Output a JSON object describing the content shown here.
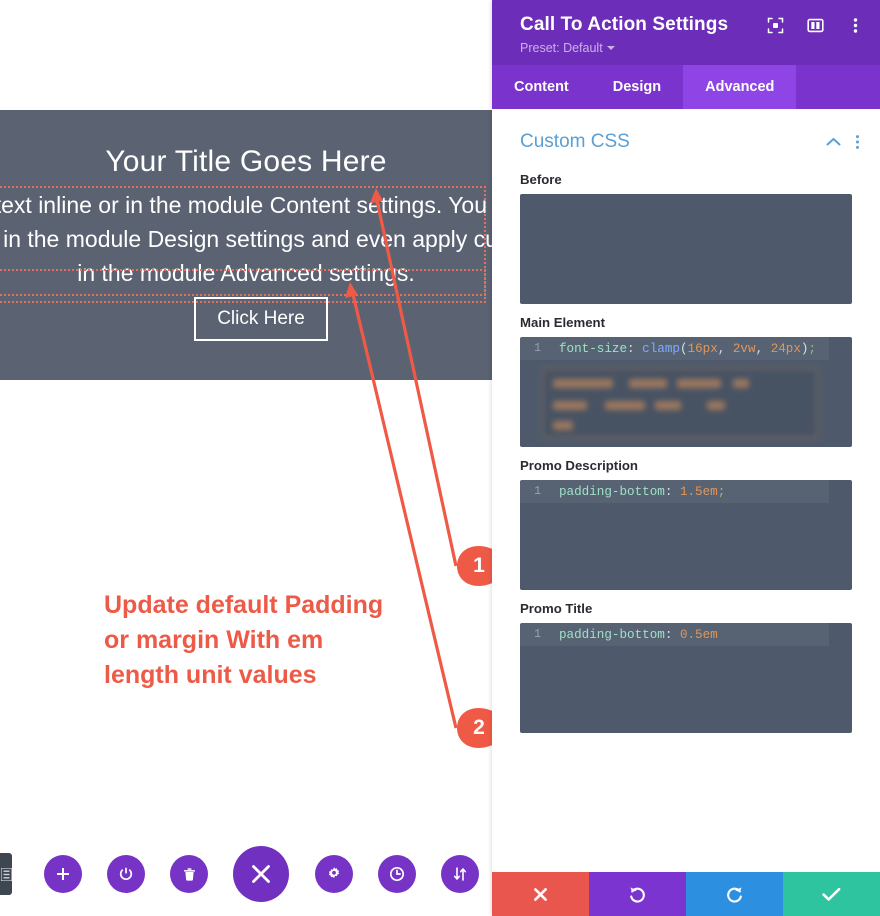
{
  "canvas": {
    "cta": {
      "title": "Your Title Goes Here",
      "description": "Edit or remove this text inline or in the module Content settings. You can also style every aspect of this content in the module Design settings and even apply custom CSS to this text in the module Advanced settings.",
      "button_label": "Click Here"
    },
    "annotation": "Update default Padding or margin With em length unit values",
    "markers": [
      {
        "label": "1"
      },
      {
        "label": "2"
      }
    ],
    "toolbar": [
      {
        "name": "add-button",
        "icon": "plus-icon"
      },
      {
        "name": "enable-disable-button",
        "icon": "power-icon"
      },
      {
        "name": "delete-button",
        "icon": "trash-icon"
      },
      {
        "name": "close-builder-button",
        "icon": "close-x-icon"
      },
      {
        "name": "settings-button",
        "icon": "gear-icon"
      },
      {
        "name": "history-button",
        "icon": "clock-icon"
      },
      {
        "name": "responsive-button",
        "icon": "sort-updown-icon"
      }
    ],
    "left_tab_icon": "list-icon"
  },
  "settings": {
    "title": "Call To Action Settings",
    "preset_label": "Preset: Default",
    "header_icons": [
      {
        "name": "focus-icon"
      },
      {
        "name": "layout-panel-icon"
      },
      {
        "name": "more-vertical-icon"
      }
    ],
    "tabs": [
      {
        "label": "Content",
        "active": false
      },
      {
        "label": "Design",
        "active": false
      },
      {
        "label": "Advanced",
        "active": true
      }
    ],
    "section": {
      "title": "Custom CSS",
      "collapse_icon": "chevron-up-icon",
      "more_icon": "more-vertical-icon"
    },
    "fields": [
      {
        "label": "Before",
        "line_number": "",
        "code": "",
        "empty": true
      },
      {
        "label": "Main Element",
        "line_number": "1",
        "code_tokens": [
          {
            "t": "font-size",
            "c": "prop"
          },
          {
            "t": ": ",
            "c": "punc"
          },
          {
            "t": "clamp",
            "c": "fn"
          },
          {
            "t": "(",
            "c": "punc"
          },
          {
            "t": "16px",
            "c": "num"
          },
          {
            "t": ", ",
            "c": "punc"
          },
          {
            "t": "2vw",
            "c": "num"
          },
          {
            "t": ", ",
            "c": "punc"
          },
          {
            "t": "24px",
            "c": "num"
          },
          {
            "t": ")",
            "c": "punc"
          },
          {
            "t": ";",
            "c": "semi"
          }
        ],
        "code_plain": "font-size: clamp(16px, 2vw, 24px);",
        "has_tooltip": true
      },
      {
        "label": "Promo Description",
        "line_number": "1",
        "code_tokens": [
          {
            "t": "padding-bottom",
            "c": "prop"
          },
          {
            "t": ": ",
            "c": "punc"
          },
          {
            "t": "1.5em",
            "c": "num"
          },
          {
            "t": ";",
            "c": "semi"
          }
        ],
        "code_plain": "padding-bottom: 1.5em;",
        "marker": "1"
      },
      {
        "label": "Promo Title",
        "line_number": "1",
        "code_tokens": [
          {
            "t": "padding-bottom",
            "c": "prop"
          },
          {
            "t": ": ",
            "c": "punc"
          },
          {
            "t": "0.5em",
            "c": "num"
          }
        ],
        "code_plain": "padding-bottom: 0.5em",
        "marker": "2"
      }
    ],
    "footer": [
      {
        "name": "cancel-button",
        "icon": "close-x-icon",
        "color": "#e8564d"
      },
      {
        "name": "undo-button",
        "icon": "undo-icon",
        "color": "#7b34cf"
      },
      {
        "name": "redo-button",
        "icon": "redo-icon",
        "color": "#2d8fe0"
      },
      {
        "name": "save-button",
        "icon": "check-icon",
        "color": "#2ec4a0"
      }
    ]
  },
  "colors": {
    "brand_purple": "#6c2eb9",
    "tab_purple": "#7a33cc",
    "tab_active": "#8f44e6",
    "code_bg": "#4e5a6b",
    "accent_orange": "#ed5a47",
    "module_bg": "#5b6272",
    "section_blue": "#5b9fd4"
  }
}
